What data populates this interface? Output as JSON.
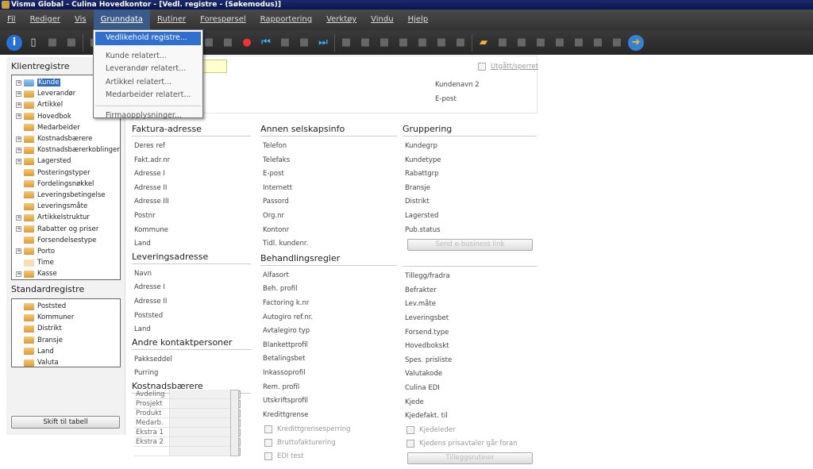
{
  "window": {
    "title": "Visma Global - Culina Hovedkontor - [Vedl. registre - (Søkemodus)]"
  },
  "menubar": [
    "Fil",
    "Rediger",
    "Vis",
    "Grunndata",
    "Rutiner",
    "Forespørsel",
    "Rapportering",
    "Verktøy",
    "Vindu",
    "Hjelp"
  ],
  "open_menu": "Grunndata",
  "dropdown": {
    "items": [
      {
        "label": "Vedlikehold registre...",
        "highlighted": true
      },
      {
        "label": "Kunde relatert..."
      },
      {
        "label": "Leverandør relatert..."
      },
      {
        "label": "Artikkel relatert..."
      },
      {
        "label": "Medarbeider relatert..."
      },
      {
        "separator": true
      },
      {
        "label": "Firmaopplysninger..."
      }
    ]
  },
  "toolbar": {
    "icons": [
      "info-icon",
      "new-document-icon",
      "save-icon",
      "delete-icon",
      "sep",
      "refresh-icon",
      "help-icon",
      "document-help-icon",
      "search-icon",
      "filter-icon",
      "image-icon",
      "disabled-icon",
      "edit-icon",
      "color-wheel-icon",
      "first-record-icon",
      "previous-record-icon",
      "next-record-icon",
      "last-record-icon",
      "sep",
      "binoculars-icon",
      "back-icon",
      "forward-icon",
      "stop-icon",
      "reload-icon",
      "home-icon",
      "find-icon",
      "sep",
      "open-folder-icon",
      "ruler-icon",
      "calculator-icon",
      "table-icon",
      "link-icon",
      "font-icon",
      "undo-icon",
      "redo-icon",
      "export-icon"
    ]
  },
  "left": {
    "client_title": "Klientregistre",
    "client_tree": [
      {
        "label": "Kunde",
        "expand": true,
        "selected": true,
        "folder": "blue"
      },
      {
        "label": "Leverandør",
        "expand": true
      },
      {
        "label": "Artikkel",
        "expand": true
      },
      {
        "label": "Hovedbok",
        "expand": true
      },
      {
        "label": "Medarbeider"
      },
      {
        "label": "Kostnadsbærere",
        "expand": true
      },
      {
        "label": "Kostnadsbærerkoblinger",
        "expand": true
      },
      {
        "label": "Lagersted",
        "expand": true
      },
      {
        "label": "Posteringstyper"
      },
      {
        "label": "Fordelingsnøkkel"
      },
      {
        "label": "Leveringsbetingelse"
      },
      {
        "label": "Leveringsmåte"
      },
      {
        "label": "Artikkelstruktur",
        "expand": true
      },
      {
        "label": "Rabatter og priser",
        "expand": true
      },
      {
        "label": "Forsendelsestype"
      },
      {
        "label": "Porto",
        "expand": true
      },
      {
        "label": "Time",
        "folder": "pale"
      },
      {
        "label": "Kasse",
        "expand": true
      }
    ],
    "standard_title": "Standardregistre",
    "standard_tree": [
      {
        "label": "Poststed"
      },
      {
        "label": "Kommuner"
      },
      {
        "label": "Distrikt"
      },
      {
        "label": "Bransje"
      },
      {
        "label": "Land"
      },
      {
        "label": "Valuta"
      }
    ],
    "switch_button": "Skift til tabell"
  },
  "top": {
    "inactive_checkbox": "Utgått/sperret",
    "field1": "Kundenavn 2",
    "field2": "E-post"
  },
  "columns": [
    {
      "sections": [
        {
          "title": "Faktura-adresse",
          "rows": [
            "Deres ref",
            "Fakt.adr.nr",
            "Adresse I",
            "Adresse II",
            "Adresse III",
            "Postnr",
            "Kommune",
            "Land"
          ]
        },
        {
          "title": "Leveringsadresse",
          "rows": [
            "Navn",
            "Adresse I",
            "Adresse II",
            "Poststed",
            "Land"
          ]
        },
        {
          "title": "Andre kontaktpersoner",
          "rows": [
            "Pakkseddel",
            "Purring"
          ]
        },
        {
          "title": "Kostnadsbærere",
          "rows": []
        }
      ]
    },
    {
      "sections": [
        {
          "title": "Annen selskapsinfo",
          "rows": [
            "Telefon",
            "Telefaks",
            "E-post",
            "Internett",
            "Passord",
            "Org.nr",
            "Kontonr",
            "Tidl. kundenr."
          ]
        },
        {
          "title": "Behandlingsregler",
          "rows": [
            "Alfasort",
            "Beh. profil",
            "Factoring k.nr",
            "Autogiro ref.nr.",
            "Avtalegiro typ",
            "Blankettprofil",
            "Betalingsbet",
            "Inkassoprofil",
            "Rem. profil",
            "Utskriftsprofil",
            "Kredittgrense"
          ],
          "checkboxes": [
            "Kredittgrensesperring",
            "Bruttofakturering",
            "EDI test"
          ]
        }
      ]
    },
    {
      "sections": [
        {
          "title": "Gruppering",
          "rows": [
            "Kundegrp",
            "Kundetype",
            "Rabattgrp",
            "Bransje",
            "Distrikt",
            "Lagersted",
            "Pub.status"
          ],
          "button": "Send e-business link"
        },
        {
          "title": "",
          "rows": [
            "Tillegg/fradra",
            "Befrakter",
            "Lev.måte",
            "Leveringsbet",
            "Forsend.type",
            "Hovedbokskt",
            "Spes. prisliste",
            "Valutakode",
            "Culina EDI",
            "Kjede",
            "Kjedefakt. til"
          ],
          "checkboxes": [
            "Kjedeleder",
            "Kjedens prisavtaler går foran"
          ],
          "button": "Tilleggsrutiner"
        }
      ]
    }
  ],
  "cost_grid": [
    "Avdeling",
    "Prosjekt",
    "Produkt",
    "Medarb.",
    "Ekstra 1",
    "Ekstra 2",
    ""
  ]
}
